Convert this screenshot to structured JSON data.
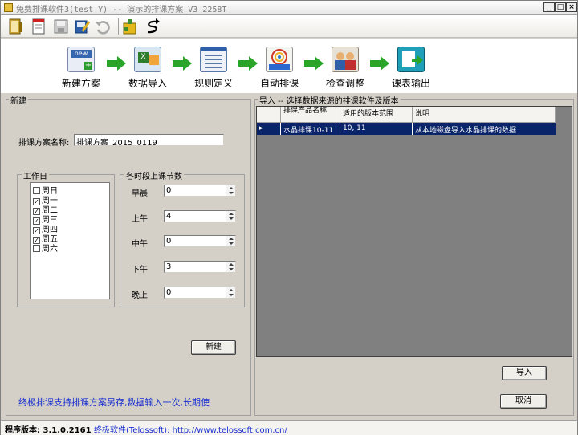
{
  "window": {
    "title": "免费排课软件3(test  Y) -- 演示的排课方案_V3  2258T",
    "controls": [
      "_",
      "□",
      "×"
    ]
  },
  "toolbar": {
    "icons": [
      "open-book-icon",
      "new-document-icon",
      "save-disk-icon",
      "edit-icon",
      "undo-icon",
      "puzzle-icon",
      "redo-s-arrow-icon"
    ]
  },
  "wizard": {
    "steps": [
      {
        "label": "新建方案",
        "icon": "new-plan-icon"
      },
      {
        "label": "数据导入",
        "icon": "data-import-icon"
      },
      {
        "label": "规则定义",
        "icon": "rules-icon"
      },
      {
        "label": "自动排课",
        "icon": "auto-schedule-icon"
      },
      {
        "label": "检查调整",
        "icon": "check-adjust-icon"
      },
      {
        "label": "课表输出",
        "icon": "export-icon"
      }
    ]
  },
  "left_panel": {
    "title": "新建",
    "plan_name_label": "排课方案名称:",
    "plan_name_value": "排课方案_2015_0119",
    "workdays": {
      "title": "工作日",
      "items": [
        {
          "label": "周日",
          "checked": false
        },
        {
          "label": "周一",
          "checked": true
        },
        {
          "label": "周二",
          "checked": true
        },
        {
          "label": "周三",
          "checked": true
        },
        {
          "label": "周四",
          "checked": true
        },
        {
          "label": "周五",
          "checked": true
        },
        {
          "label": "周六",
          "checked": false
        }
      ]
    },
    "periods": {
      "title": "各时段上课节数",
      "items": [
        {
          "label": "早晨",
          "value": "0"
        },
        {
          "label": "上午",
          "value": "4"
        },
        {
          "label": "中午",
          "value": "0"
        },
        {
          "label": "下午",
          "value": "3"
        },
        {
          "label": "晚上",
          "value": "0"
        }
      ]
    },
    "new_button": "新建"
  },
  "right_panel": {
    "title": "导入 -- 选择数据来源的排课软件及版本",
    "columns": [
      "排课产品名称",
      "适用的版本范围",
      "说明"
    ],
    "rows": [
      {
        "product": "水晶排课10-11",
        "versions": "10, 11",
        "description": "从本地磁盘导入水晶排课的数据"
      }
    ],
    "import_button": "导入",
    "cancel_button": "取消"
  },
  "note": "终极排课支持排课方案另存,数据输入一次,长期使",
  "status": {
    "version_label": "程序版本: 3.1.0.2161",
    "company": "终极软件(Telossoft): http://www.telossoft.com.cn/"
  }
}
